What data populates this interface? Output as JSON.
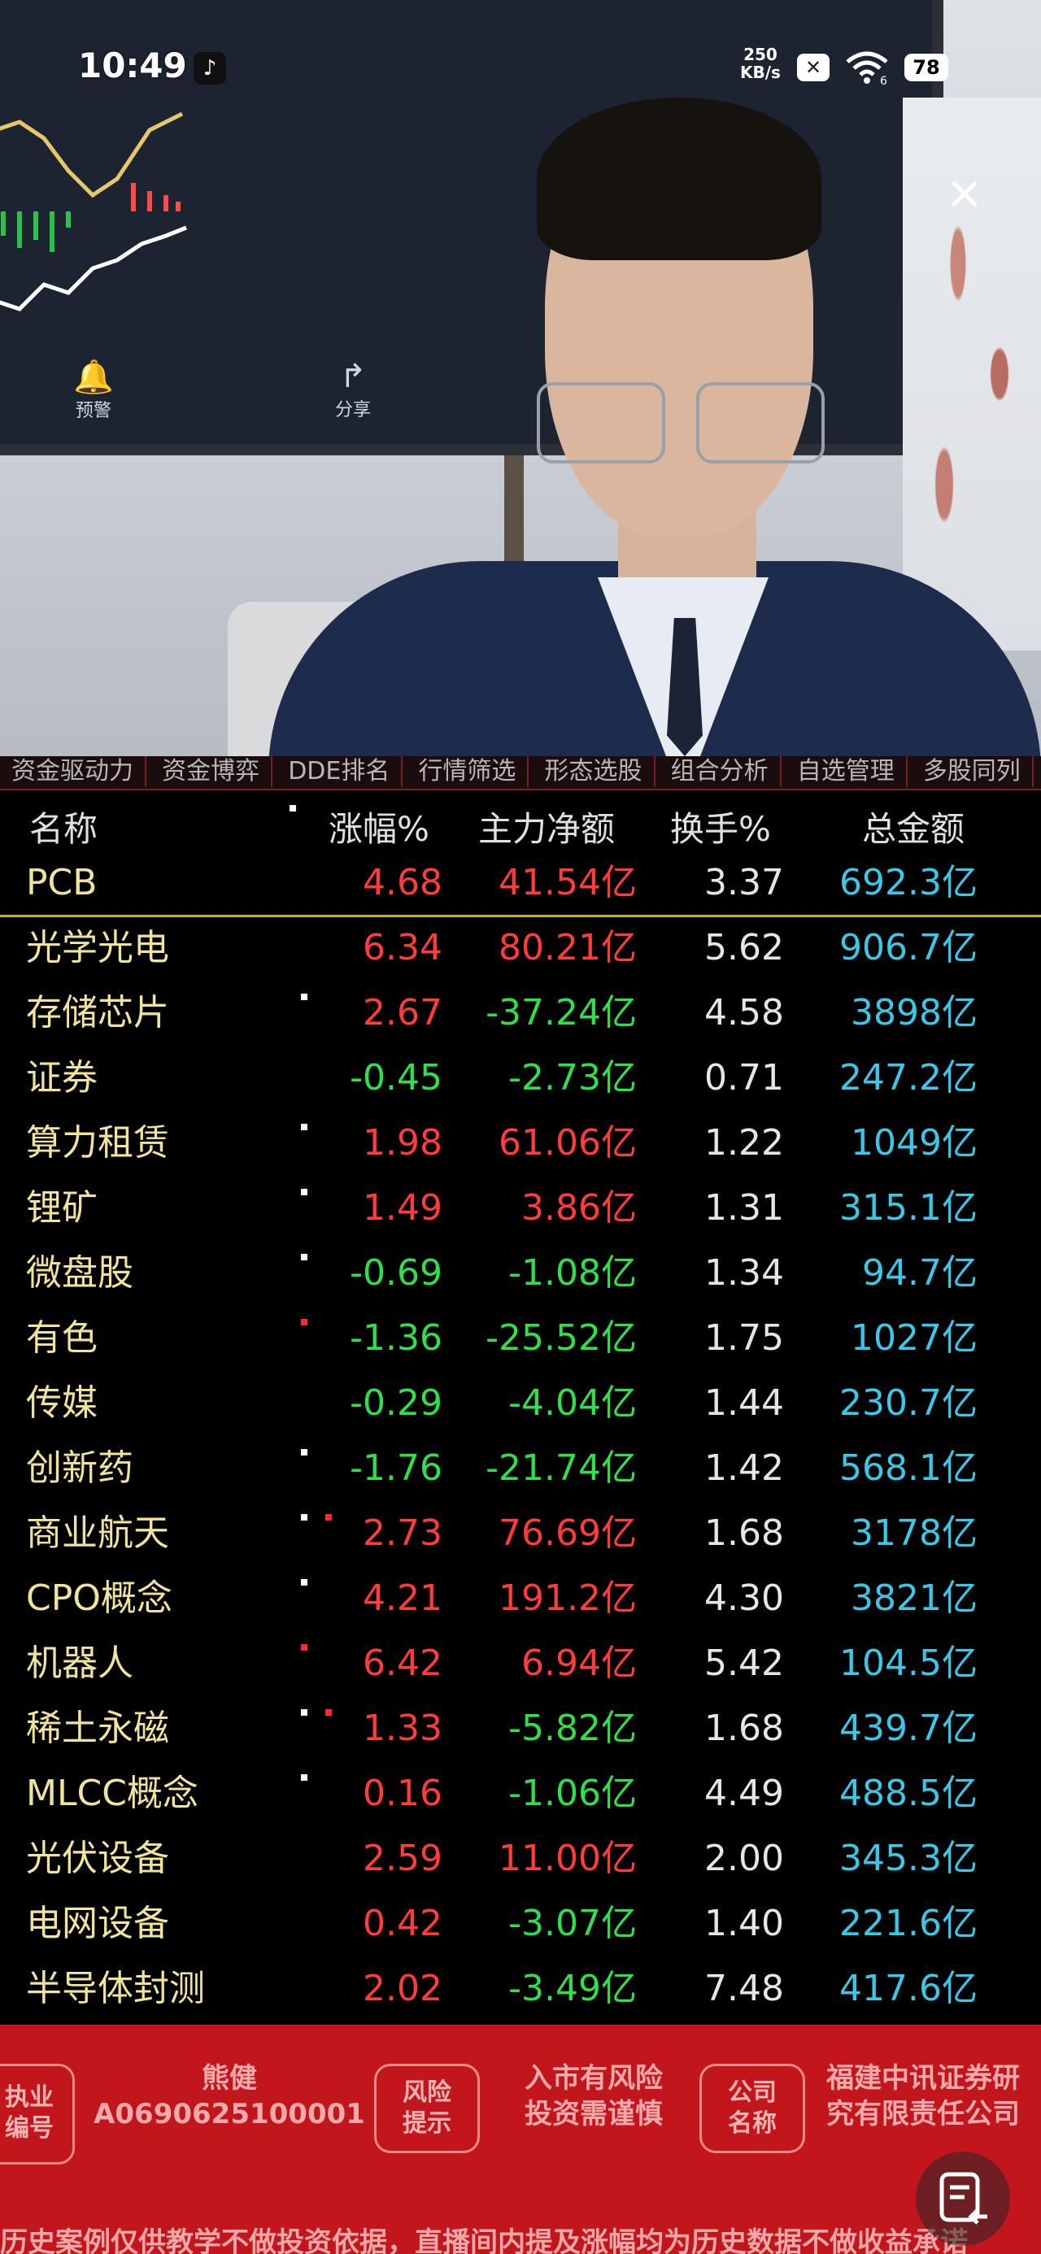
{
  "status_bar": {
    "time": "10:49",
    "app_icon": "tiktok-icon",
    "net_speed_value": "250",
    "net_speed_unit": "KB/s",
    "battery": "78",
    "wifi_tag": "6"
  },
  "monitor": {
    "alert_label": "预警",
    "share_label": "分享"
  },
  "menu_strip": [
    "资金驱动力",
    "资金博弈",
    "DDE排名",
    "行情筛选",
    "形态选股",
    "组合分析",
    "自选管理",
    "多股同列"
  ],
  "table": {
    "headers": {
      "name": "名称",
      "change_pct": "涨幅%",
      "main_net": "主力净额",
      "turnover": "换手%",
      "total_amount": "总金额"
    },
    "rows": [
      {
        "name": "PCB",
        "change_pct": "4.68",
        "main_net": "41.54亿",
        "turnover": "3.37",
        "total_amount": "692.3亿",
        "pct_dir": "up",
        "net_dir": "up",
        "marks": []
      },
      {
        "name": "光学光电",
        "change_pct": "6.34",
        "main_net": "80.21亿",
        "turnover": "5.62",
        "total_amount": "906.7亿",
        "pct_dir": "up",
        "net_dir": "up",
        "marks": []
      },
      {
        "name": "存储芯片",
        "change_pct": "2.67",
        "main_net": "-37.24亿",
        "turnover": "4.58",
        "total_amount": "3898亿",
        "pct_dir": "up",
        "net_dir": "down",
        "marks": [
          "w"
        ]
      },
      {
        "name": "证券",
        "change_pct": "-0.45",
        "main_net": "-2.73亿",
        "turnover": "0.71",
        "total_amount": "247.2亿",
        "pct_dir": "down",
        "net_dir": "down",
        "marks": []
      },
      {
        "name": "算力租赁",
        "change_pct": "1.98",
        "main_net": "61.06亿",
        "turnover": "1.22",
        "total_amount": "1049亿",
        "pct_dir": "up",
        "net_dir": "up",
        "marks": [
          "w"
        ]
      },
      {
        "name": "锂矿",
        "change_pct": "1.49",
        "main_net": "3.86亿",
        "turnover": "1.31",
        "total_amount": "315.1亿",
        "pct_dir": "up",
        "net_dir": "up",
        "marks": [
          "w"
        ]
      },
      {
        "name": "微盘股",
        "change_pct": "-0.69",
        "main_net": "-1.08亿",
        "turnover": "1.34",
        "total_amount": "94.7亿",
        "pct_dir": "down",
        "net_dir": "down",
        "marks": [
          "w"
        ]
      },
      {
        "name": "有色",
        "change_pct": "-1.36",
        "main_net": "-25.52亿",
        "turnover": "1.75",
        "total_amount": "1027亿",
        "pct_dir": "down",
        "net_dir": "down",
        "marks": [
          "r"
        ]
      },
      {
        "name": "传媒",
        "change_pct": "-0.29",
        "main_net": "-4.04亿",
        "turnover": "1.44",
        "total_amount": "230.7亿",
        "pct_dir": "down",
        "net_dir": "down",
        "marks": []
      },
      {
        "name": "创新药",
        "change_pct": "-1.76",
        "main_net": "-21.74亿",
        "turnover": "1.42",
        "total_amount": "568.1亿",
        "pct_dir": "down",
        "net_dir": "down",
        "marks": [
          "w"
        ]
      },
      {
        "name": "商业航天",
        "change_pct": "2.73",
        "main_net": "76.69亿",
        "turnover": "1.68",
        "total_amount": "3178亿",
        "pct_dir": "up",
        "net_dir": "up",
        "marks": [
          "w",
          "r"
        ]
      },
      {
        "name": "CPO概念",
        "change_pct": "4.21",
        "main_net": "191.2亿",
        "turnover": "4.30",
        "total_amount": "3821亿",
        "pct_dir": "up",
        "net_dir": "up",
        "marks": [
          "w"
        ]
      },
      {
        "name": "机器人",
        "change_pct": "6.42",
        "main_net": "6.94亿",
        "turnover": "5.42",
        "total_amount": "104.5亿",
        "pct_dir": "up",
        "net_dir": "up",
        "marks": [
          "r"
        ]
      },
      {
        "name": "稀土永磁",
        "change_pct": "1.33",
        "main_net": "-5.82亿",
        "turnover": "1.68",
        "total_amount": "439.7亿",
        "pct_dir": "up",
        "net_dir": "down",
        "marks": [
          "w",
          "r"
        ]
      },
      {
        "name": "MLCC概念",
        "change_pct": "0.16",
        "main_net": "-1.06亿",
        "turnover": "4.49",
        "total_amount": "488.5亿",
        "pct_dir": "up",
        "net_dir": "down",
        "marks": [
          "w"
        ]
      },
      {
        "name": "光伏设备",
        "change_pct": "2.59",
        "main_net": "11.00亿",
        "turnover": "2.00",
        "total_amount": "345.3亿",
        "pct_dir": "up",
        "net_dir": "up",
        "marks": []
      },
      {
        "name": "电网设备",
        "change_pct": "0.42",
        "main_net": "-3.07亿",
        "turnover": "1.40",
        "total_amount": "221.6亿",
        "pct_dir": "up",
        "net_dir": "down",
        "marks": []
      },
      {
        "name": "半导体封测",
        "change_pct": "2.02",
        "main_net": "-3.49亿",
        "turnover": "7.48",
        "total_amount": "417.6亿",
        "pct_dir": "up",
        "net_dir": "down",
        "marks": []
      }
    ]
  },
  "banner": {
    "cert_box": "执业\n编号",
    "presenter_name": "熊健",
    "cert_number": "A0690625100001",
    "risk_box": "风险\n提示",
    "risk_text": "入市有风险\n投资需谨慎",
    "company_box": "公司\n名称",
    "company_text": "福建中讯证券研\n究有限责任公司",
    "disclaimer": "历史案例仅供教学不做投资依据，直播间内提及涨幅均为历史数据不做收益承诺"
  },
  "colors": {
    "up": "#ff3b3b",
    "down": "#2ee04a",
    "name": "#f0e39a",
    "total": "#39c8e8",
    "banner_bg": "#c2161d"
  }
}
